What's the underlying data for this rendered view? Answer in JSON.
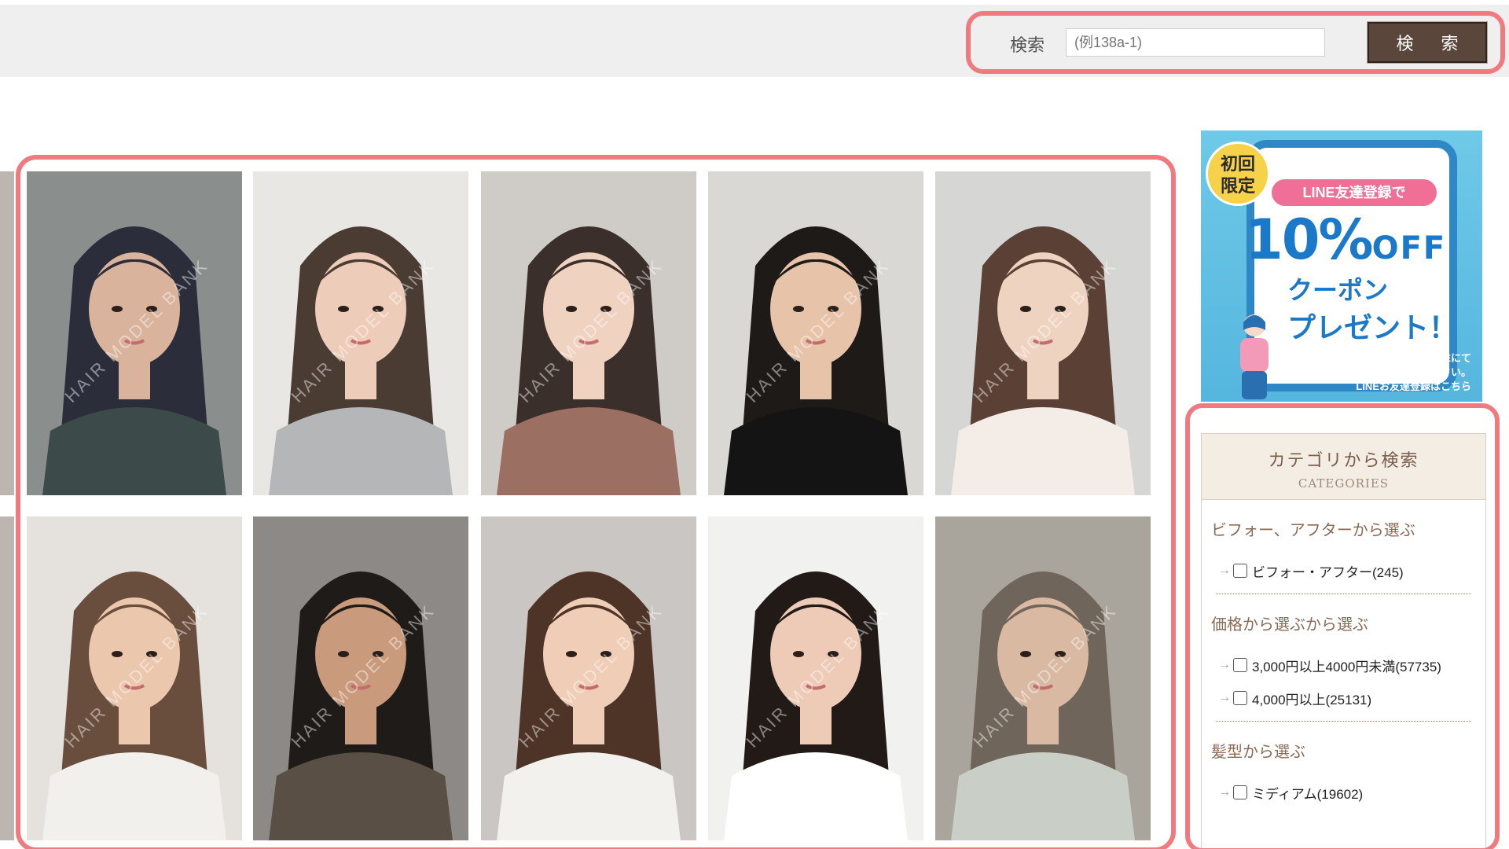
{
  "search": {
    "label": "検索",
    "placeholder": "(例138a-1)",
    "button_label": "検 索"
  },
  "photos": [
    {
      "watermark": "HAIR MODEL BANK",
      "bg": "#8a8f8e",
      "hair": "#2b2e3a",
      "cloth": "#3d4a4a",
      "skin": "#d9b39c"
    },
    {
      "watermark": "HAIR MODEL BANK",
      "bg": "#e9e7e4",
      "hair": "#4a3b33",
      "cloth": "#b4b6b8",
      "skin": "#edcdb9"
    },
    {
      "watermark": "HAIR MODEL BANK",
      "bg": "#cfcbc6",
      "hair": "#3a2f2a",
      "cloth": "#9c6f63",
      "skin": "#f0d2c1"
    },
    {
      "watermark": "HAIR MODEL BANK",
      "bg": "#dad8d5",
      "hair": "#1e1a18",
      "cloth": "#141414",
      "skin": "#e7c3a9"
    },
    {
      "watermark": "HAIR MODEL BANK",
      "bg": "#d6d6d4",
      "hair": "#5a4035",
      "cloth": "#f4ece6",
      "skin": "#efd3c1"
    },
    {
      "watermark": "HAIR MODEL BANK",
      "bg": "#e5e1dc",
      "hair": "#6a4e3d",
      "cloth": "#f2f0ec",
      "skin": "#ebc7ad"
    },
    {
      "watermark": "HAIR MODEL BANK",
      "bg": "#8c8987",
      "hair": "#1f1b19",
      "cloth": "#5a4f45",
      "skin": "#c99a7b"
    },
    {
      "watermark": "HAIR MODEL BANK",
      "bg": "#c9c6c3",
      "hair": "#4d3426",
      "cloth": "#f3f1ee",
      "skin": "#f0cdb7"
    },
    {
      "watermark": "HAIR MODEL BANK",
      "bg": "#f1f1ef",
      "hair": "#211a17",
      "cloth": "#ffffff",
      "skin": "#edcbb6"
    },
    {
      "watermark": "HAIR MODEL BANK",
      "bg": "#a9a49c",
      "hair": "#6f655b",
      "cloth": "#c9cfc6",
      "skin": "#d9b9a1"
    }
  ],
  "banner": {
    "badge_line1": "初回",
    "badge_line2": "限定",
    "line_pill": "LINE友達登録で",
    "off_big": "10%",
    "off_small": "OFF",
    "coupon": "クーポン",
    "present": "プレゼント！",
    "note_line1": "友達登録後、LINEにて",
    "note_line2": "「10」と送信ください。",
    "note_line3": "LINEお友達登録はこちら",
    "colors": {
      "bg": "#5fbfe3",
      "pink": "#ef6f97",
      "blue": "#1b79c9",
      "yellow": "#f6d24a"
    }
  },
  "categories": {
    "title": "カテゴリから検索",
    "subtitle": "CATEGORIES",
    "sections": [
      {
        "title": "ビフォー、アフターから選ぶ",
        "items": [
          {
            "label": "ビフォー・アフター(245)"
          }
        ]
      },
      {
        "title": "価格から選ぶから選ぶ",
        "items": [
          {
            "label": "3,000円以上4000円未満(57735)"
          },
          {
            "label": "4,000円以上(25131)"
          }
        ]
      },
      {
        "title": "髪型から選ぶ",
        "items": [
          {
            "label": "ミディアム(19602)"
          }
        ]
      }
    ]
  },
  "colors": {
    "highlight": "#ef7b80",
    "button": "#5b463b",
    "topbar": "#efefef"
  }
}
